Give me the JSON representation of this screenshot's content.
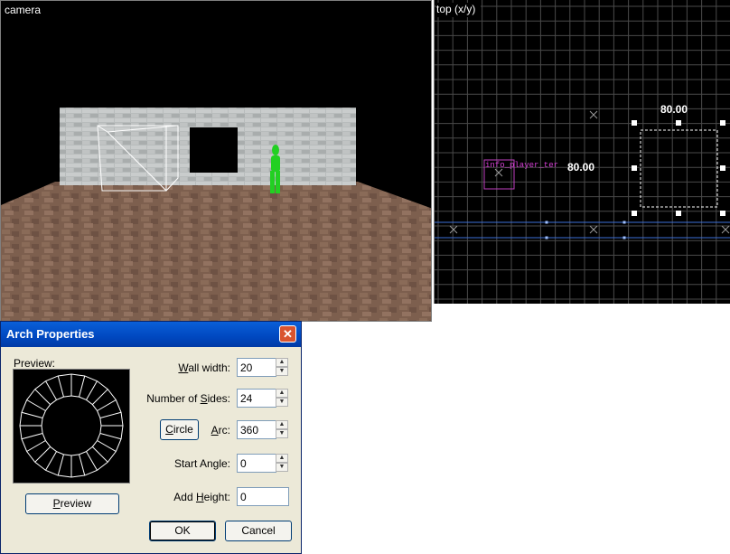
{
  "camera": {
    "label": "camera"
  },
  "top_view": {
    "label": "top (x/y)",
    "dim_width": "80.00",
    "dim_height": "80.00",
    "entity_label": "info_player_ter"
  },
  "dialog": {
    "title": "Arch Properties",
    "preview_label": "Preview:",
    "wall_width": {
      "label_pre": "",
      "label_u": "W",
      "label_post": "all width:",
      "value": "20"
    },
    "num_sides": {
      "label_pre": "Number of ",
      "label_u": "S",
      "label_post": "ides:",
      "value": "24"
    },
    "circle_button": {
      "label_u": "C",
      "label_post": "ircle"
    },
    "arc": {
      "label_pre": "",
      "label_u": "A",
      "label_post": "rc:",
      "value": "360"
    },
    "start_angle": {
      "label": "Start Angle:",
      "value": "0"
    },
    "add_height": {
      "label_pre": "Add ",
      "label_u": "H",
      "label_post": "eight:",
      "value": "0"
    },
    "preview_button": {
      "label_u": "P",
      "label_post": "review"
    },
    "ok_button": "OK",
    "cancel_button": "Cancel",
    "close_glyph": "✕"
  }
}
